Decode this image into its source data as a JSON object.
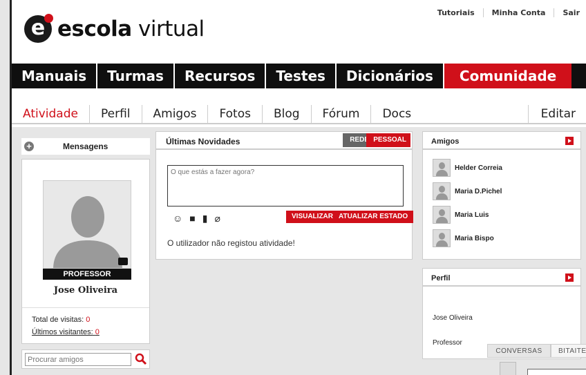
{
  "header": {
    "logo_mark": "e",
    "logo_bold": "escola",
    "logo_light": " virtual",
    "top_links": [
      "Tutoriais",
      "Minha Conta",
      "Sair"
    ]
  },
  "main_nav": {
    "items": [
      "Manuais",
      "Turmas",
      "Recursos",
      "Testes",
      "Dicionários",
      "Comunidade"
    ],
    "active": "Comunidade"
  },
  "sub_nav": {
    "tabs": [
      "Atividade",
      "Perfil",
      "Amigos",
      "Fotos",
      "Blog",
      "Fórum",
      "Docs"
    ],
    "active": "Atividade",
    "edit_label": "Editar"
  },
  "left": {
    "messages_label": "Mensagens",
    "badge": "PROFESSOR",
    "name": "Jose Oliveira",
    "visits_label": "Total de visitas:",
    "visits_value": "0",
    "visitors_label": "Últimos visitantes:",
    "visitors_value": "0",
    "search_placeholder": "Procurar amigos"
  },
  "news": {
    "title": "Últimas Novidades",
    "tag_rede": "REDE",
    "tag_pessoal": "PESSOAL",
    "status_placeholder": "O que estás a fazer agora?",
    "btn_visualizar": "VISUALIZAR",
    "btn_atualizar": "ATUALIZAR ESTADO",
    "empty_text": "O utilizador não registou atividade!",
    "icons": [
      "smiley-icon",
      "video-camera-icon",
      "film-icon",
      "paperclip-icon"
    ]
  },
  "friends": {
    "title": "Amigos",
    "list": [
      "Helder Correia",
      "Maria D.Pichel",
      "Maria Luis",
      "Maria Bispo"
    ]
  },
  "perfil": {
    "title": "Perfil",
    "name": "Jose Oliveira",
    "role": "Professor"
  },
  "chat": {
    "tab_conversas": "CONVERSAS",
    "tab_bitaites": "BITAITES"
  },
  "colors": {
    "accent": "#d0101a",
    "nav_bg": "#0f0f0f"
  }
}
